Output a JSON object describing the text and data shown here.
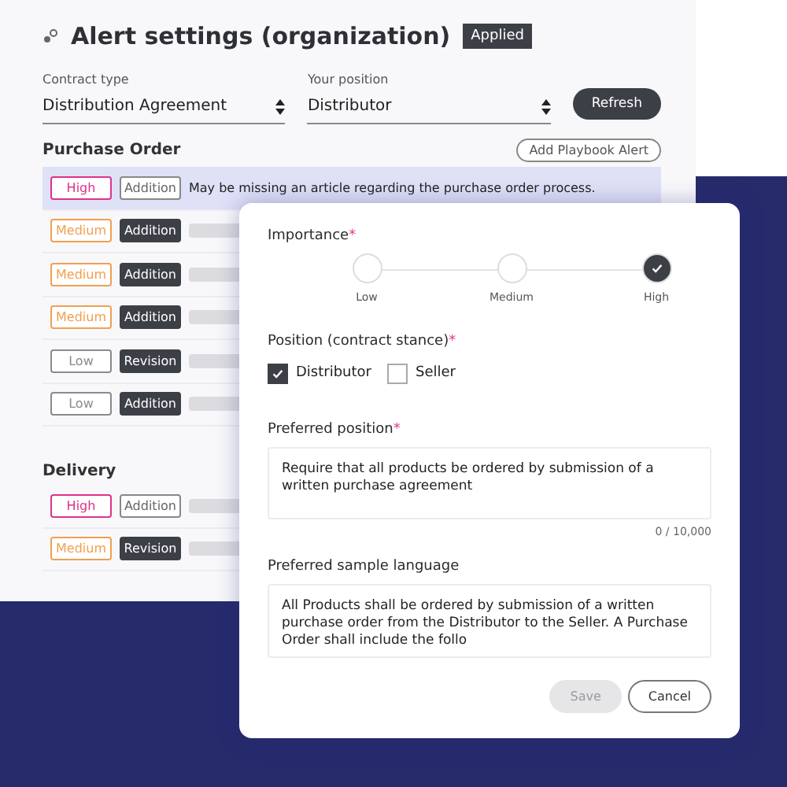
{
  "header": {
    "title": "Alert settings (organization)",
    "badge": "Applied"
  },
  "filters": [
    {
      "label": "Contract type",
      "value": "Distribution Agreement"
    },
    {
      "label": "Your position",
      "value": "Distributor"
    }
  ],
  "refresh_button": "Refresh",
  "sections": [
    {
      "title": "Purchase Order",
      "action": "Add Playbook Alert",
      "alerts": [
        {
          "priority": "High",
          "color": "#e0318a",
          "type": "Addition",
          "filled": false,
          "selected": true,
          "text": "May be missing an article regarding the purchase order process."
        },
        {
          "priority": "Medium",
          "color": "#f0a050",
          "type": "Addition",
          "filled": true,
          "selected": false
        },
        {
          "priority": "Medium",
          "color": "#f0a050",
          "type": "Addition",
          "filled": true,
          "selected": false
        },
        {
          "priority": "Medium",
          "color": "#f0a050",
          "type": "Addition",
          "filled": true,
          "selected": false
        },
        {
          "priority": "Low",
          "color": "#8a8a8f",
          "type": "Revision",
          "filled": true,
          "selected": false
        },
        {
          "priority": "Low",
          "color": "#8a8a8f",
          "type": "Addition",
          "filled": true,
          "selected": false
        }
      ]
    },
    {
      "title": "Delivery",
      "alerts": [
        {
          "priority": "High",
          "color": "#e0318a",
          "type": "Addition",
          "filled": false,
          "selected": false
        },
        {
          "priority": "Medium",
          "color": "#f0a050",
          "type": "Revision",
          "filled": true,
          "selected": false
        }
      ]
    }
  ],
  "dialog": {
    "importance": {
      "label": "Importance",
      "required_mark": "*",
      "steps": [
        {
          "label": "Low",
          "selected": false
        },
        {
          "label": "Medium",
          "selected": false
        },
        {
          "label": "High",
          "selected": true
        }
      ]
    },
    "position": {
      "label": "Position (contract stance)",
      "required_mark": "*",
      "options": [
        {
          "label": "Distributor",
          "checked": true
        },
        {
          "label": "Seller",
          "checked": false
        }
      ]
    },
    "preferred_position": {
      "label": "Preferred position",
      "required_mark": "*",
      "value": "Require that all products be ordered by submission of a written purchase agreement",
      "counter": "0 / 10,000"
    },
    "sample_language": {
      "label": "Preferred sample language",
      "value": "All Products shall be ordered by submission of a written purchase order from the Distributor to the Seller. A Purchase Order shall include the follo"
    },
    "buttons": [
      {
        "label": "Save",
        "disabled": true
      },
      {
        "label": "Cancel",
        "disabled": false
      }
    ]
  }
}
